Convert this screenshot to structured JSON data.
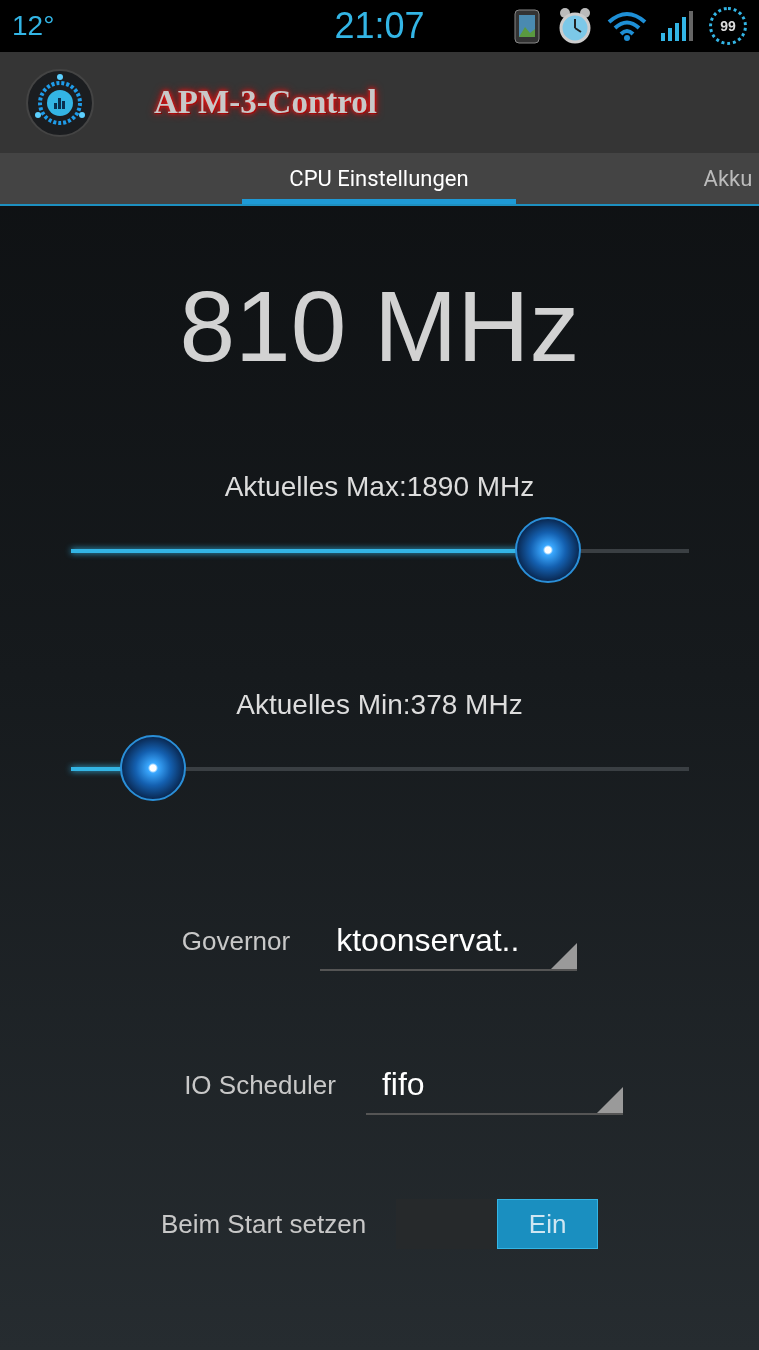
{
  "status_bar": {
    "temperature": "12°",
    "time": "21:07",
    "battery": "99"
  },
  "app_bar": {
    "title": "APM-3-Control"
  },
  "tabs": [
    {
      "label": "CPU Einstellungen",
      "selected": true
    },
    {
      "label": "Akku",
      "selected": false
    }
  ],
  "current_frequency": "810 MHz",
  "sliders": [
    {
      "label": "Aktuelles Max:1890 MHz",
      "level": 0.773
    },
    {
      "label": "Aktuelles Min:378 MHz",
      "level": 0.134
    }
  ],
  "spinners": [
    {
      "label": "Governor",
      "value": "ktoonservat.."
    },
    {
      "label": "IO Scheduler",
      "value": "fifo"
    }
  ],
  "switch": {
    "label": "Beim Start setzen",
    "on": true,
    "on_text": "Ein"
  }
}
